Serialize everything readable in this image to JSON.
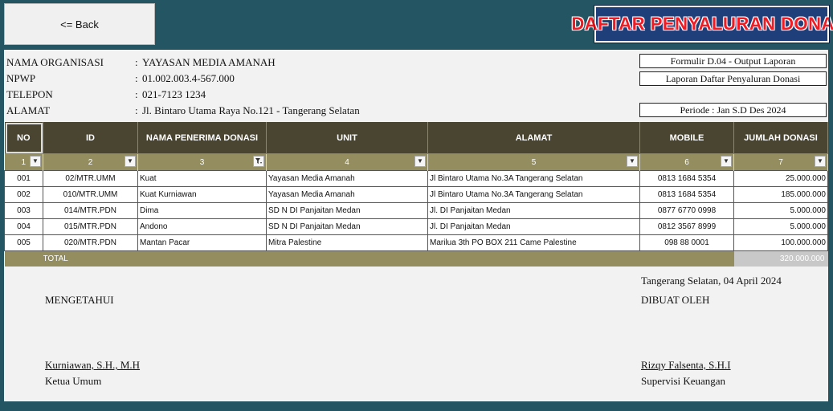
{
  "back_label": "<= Back",
  "banner_title": "DAFTAR PENYALURAN DONASI",
  "org": {
    "name_label": "NAMA ORGANISASI",
    "name_value": "YAYASAN MEDIA AMANAH",
    "npwp_label": "NPWP",
    "npwp_value": "01.002.003.4-567.000",
    "phone_label": "TELEPON",
    "phone_value": "021-7123 1234",
    "address_label": "ALAMAT",
    "address_value": "Jl. Bintaro Utama Raya No.121 - Tangerang Selatan",
    "separator": ":"
  },
  "form": {
    "code": "Formulir D.04 - Output Laporan",
    "title": "Laporan Daftar Penyaluran Donasi",
    "period": "Periode : Jan S.D Des 2024"
  },
  "table": {
    "headers": [
      "NO",
      "ID",
      "NAMA PENERIMA DONASI",
      "UNIT",
      "ALAMAT",
      "MOBILE",
      "JUMLAH DONASI"
    ],
    "filters": [
      "1",
      "2",
      "3",
      "4",
      "5",
      "6",
      "7"
    ],
    "rows": [
      [
        "001",
        "02/MTR.UMM",
        "Kuat",
        "Yayasan Media Amanah",
        "Jl Bintaro Utama No.3A Tangerang Selatan",
        "0813 1684 5354",
        "25.000.000"
      ],
      [
        "002",
        "010/MTR.UMM",
        "Kuat Kurniawan",
        "Yayasan Media Amanah",
        "Jl Bintaro Utama No.3A Tangerang Selatan",
        "0813 1684 5354",
        "185.000.000"
      ],
      [
        "003",
        "014/MTR.PDN",
        "Dima",
        "SD N DI Panjaitan Medan",
        "Jl. DI Panjaitan Medan",
        "0877 6770 0998",
        "5.000.000"
      ],
      [
        "004",
        "015/MTR.PDN",
        "Andono",
        "SD N DI Panjaitan Medan",
        "Jl. DI Panjaitan Medan",
        "0812 3567 8999",
        "5.000.000"
      ],
      [
        "005",
        "020/MTR.PDN",
        "Mantan Pacar",
        "Mitra Palestine",
        "Marilua 3th PO BOX 211  Came Palestine",
        "098 88 0001",
        "100.000.000"
      ]
    ],
    "total_label": "TOTAL",
    "total_value": "320.000.000"
  },
  "signature": {
    "place_date": "Tangerang Selatan, 04 April 2024",
    "left_title": "MENGETAHUI",
    "left_name": "Kurniawan, S.H., M.H",
    "left_role": "Ketua Umum",
    "right_title": "DIBUAT OLEH",
    "right_name": "Rizqy Falsenta, S.H.I",
    "right_role": "Supervisi Keuangan"
  },
  "colors": {
    "background": "#235563",
    "header": "#4a4531",
    "filter_row": "#938d5f",
    "banner": "#1f3f7a",
    "banner_text": "#ee1c24"
  },
  "icons": [
    "dropdown-arrow-icon",
    "filter-active-icon"
  ]
}
